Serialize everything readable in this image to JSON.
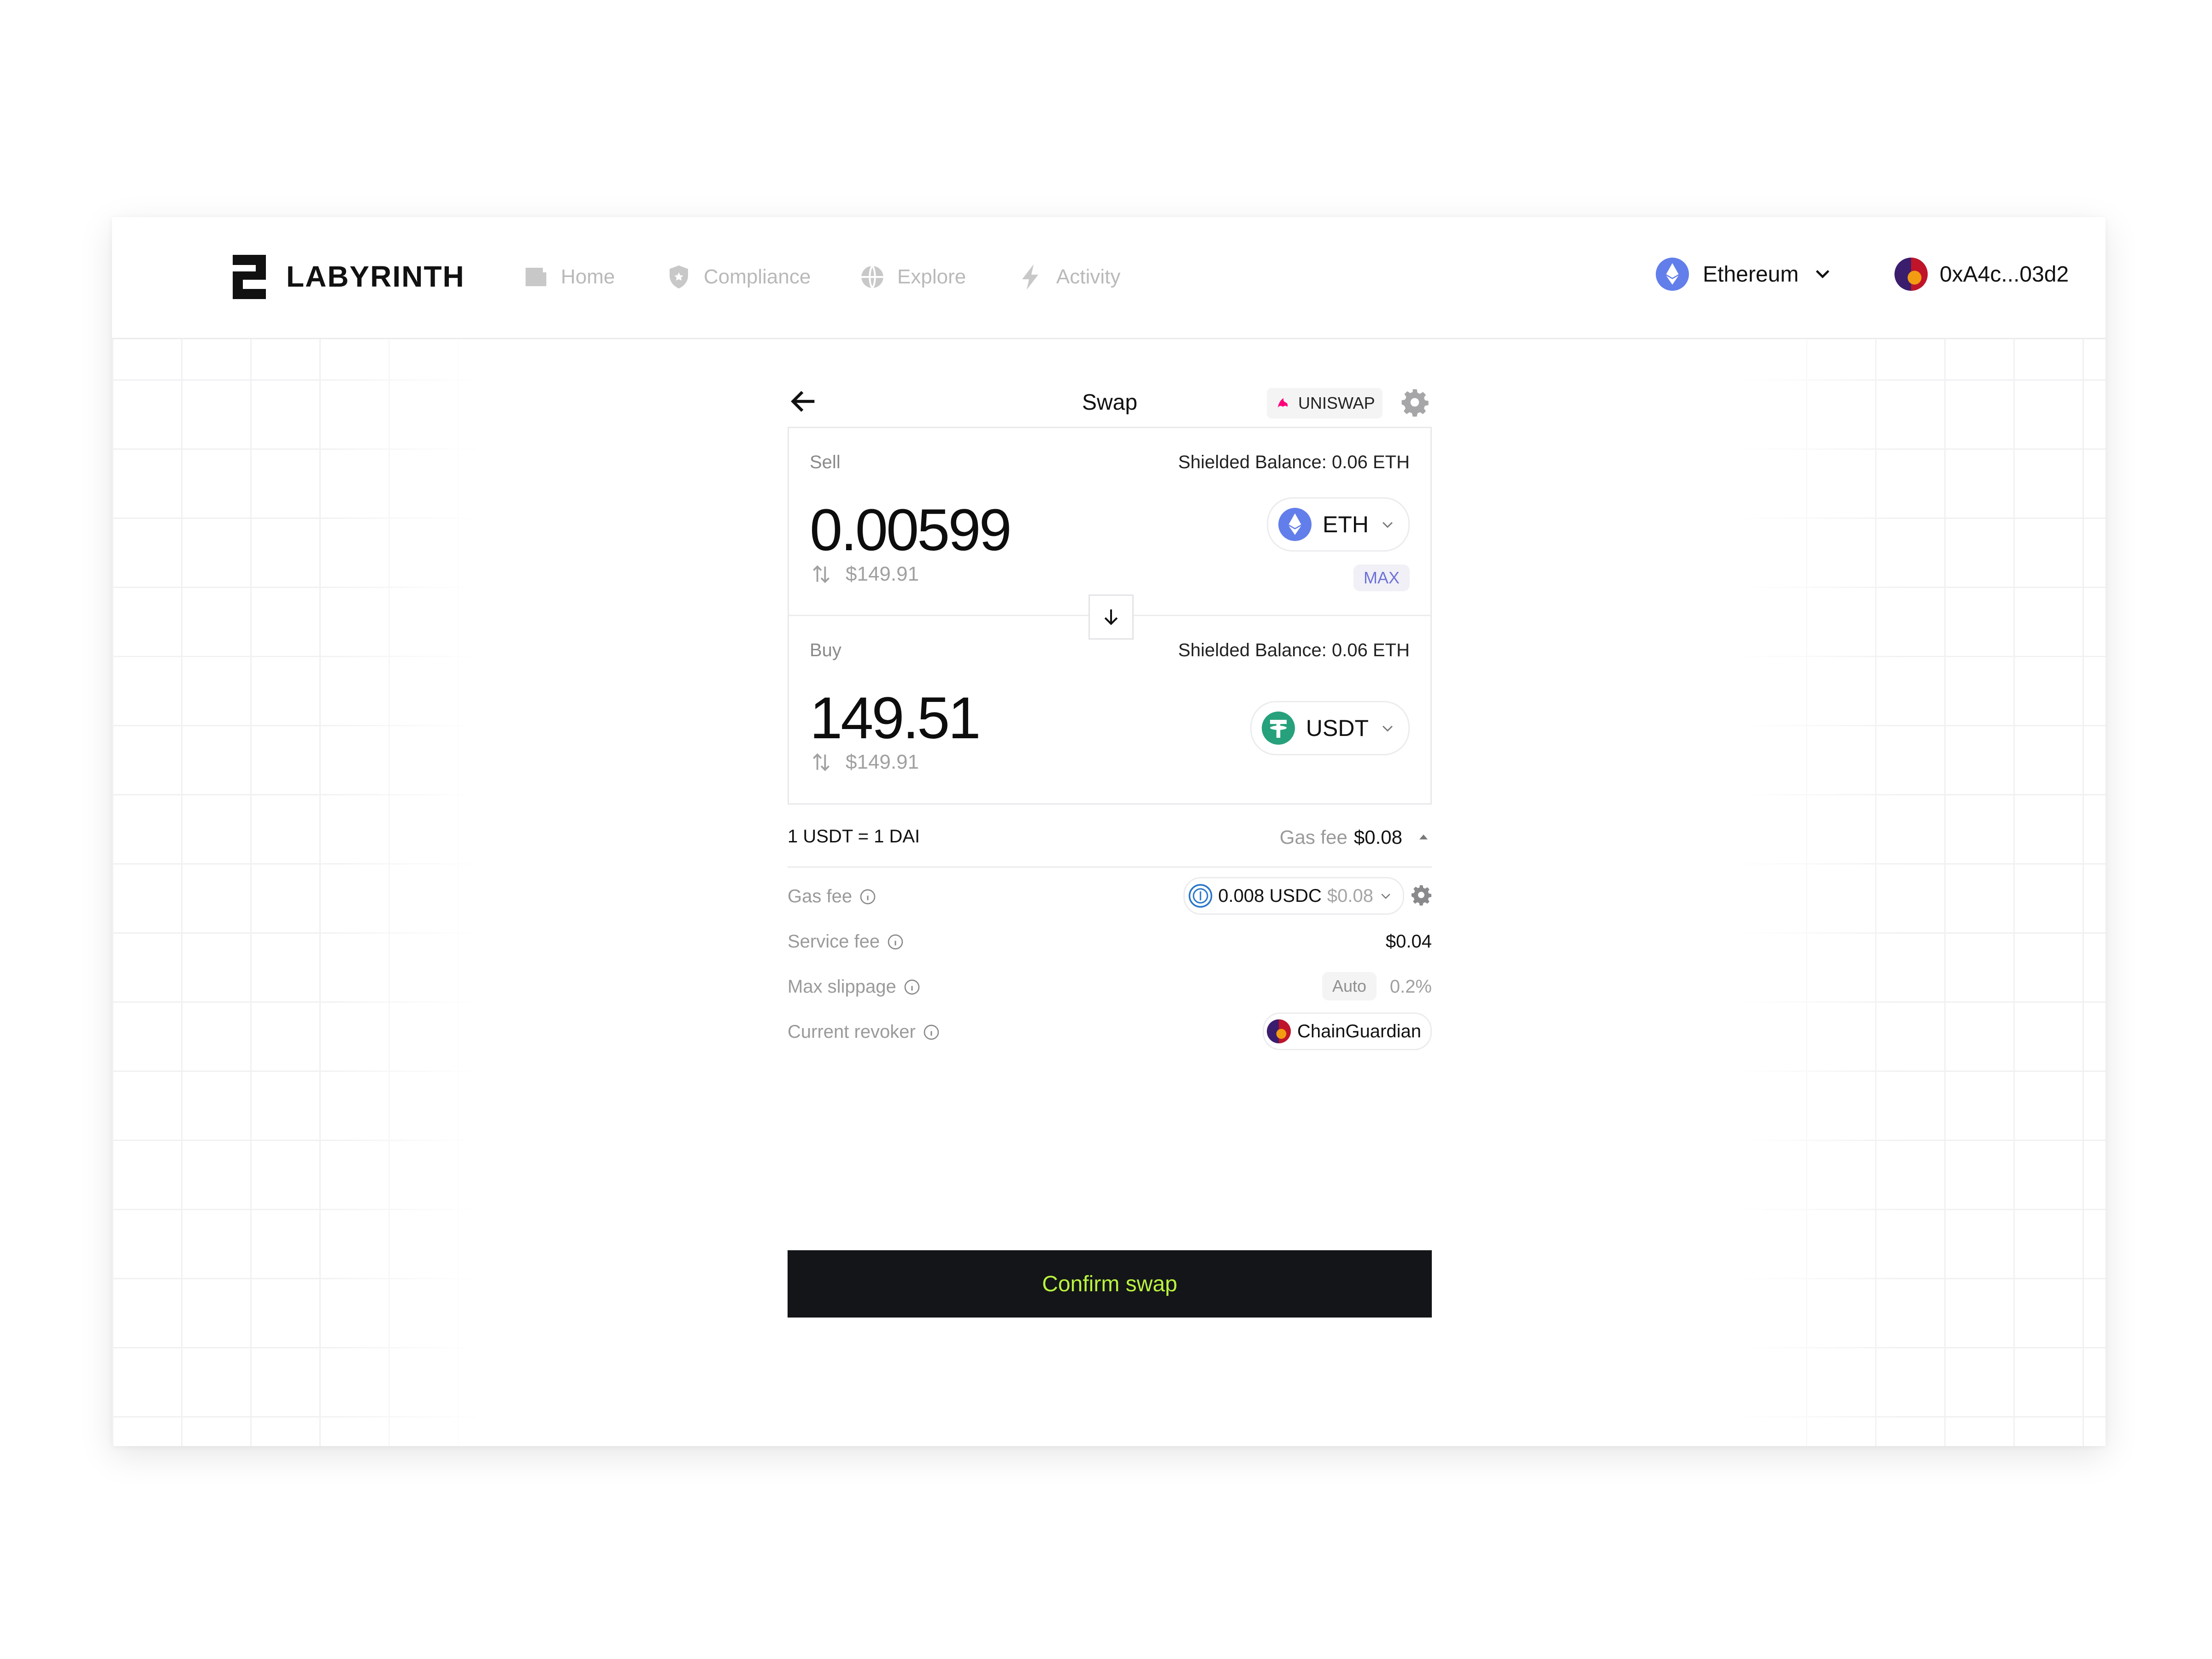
{
  "app": {
    "brand": "LABYRINTH"
  },
  "nav": [
    {
      "label": "Home",
      "icon": "wallet-icon"
    },
    {
      "label": "Compliance",
      "icon": "shield-icon"
    },
    {
      "label": "Explore",
      "icon": "globe-icon"
    },
    {
      "label": "Activity",
      "icon": "bolt-icon"
    }
  ],
  "network": {
    "label": "Ethereum",
    "icon": "ethereum-icon"
  },
  "wallet": {
    "address": "0xA4c...03d2",
    "icon": "wallet-avatar-icon"
  },
  "swap": {
    "title": "Swap",
    "dex": "UNISWAP",
    "sell": {
      "label": "Sell",
      "balance": "Shielded Balance: 0.06 ETH",
      "amount": "0.00599",
      "fiat": "$149.91",
      "token": "ETH",
      "max_label": "MAX"
    },
    "buy": {
      "label": "Buy",
      "balance": "Shielded Balance: 0.06 ETH",
      "amount": "149.51",
      "fiat": "$149.91",
      "token": "USDT"
    },
    "rate": "1 USDT = 1 DAI",
    "summary_gas_label": "Gas fee",
    "summary_gas_value": "$0.08",
    "fees": {
      "gas_label": "Gas fee",
      "gas_amount": "0.008 USDC",
      "gas_fiat": "$0.08",
      "service_label": "Service fee",
      "service_value": "$0.04",
      "slippage_label": "Max slippage",
      "slippage_mode": "Auto",
      "slippage_value": "0.2%",
      "revoker_label": "Current revoker",
      "revoker_value": "ChainGuardian"
    },
    "confirm_label": "Confirm swap"
  },
  "colors": {
    "accent_text": "#b9f33f",
    "button_bg": "#141518",
    "eth": "#627eea",
    "usdt": "#26a17b",
    "usdc": "#2775ca",
    "max_badge": "#6f72d9"
  }
}
